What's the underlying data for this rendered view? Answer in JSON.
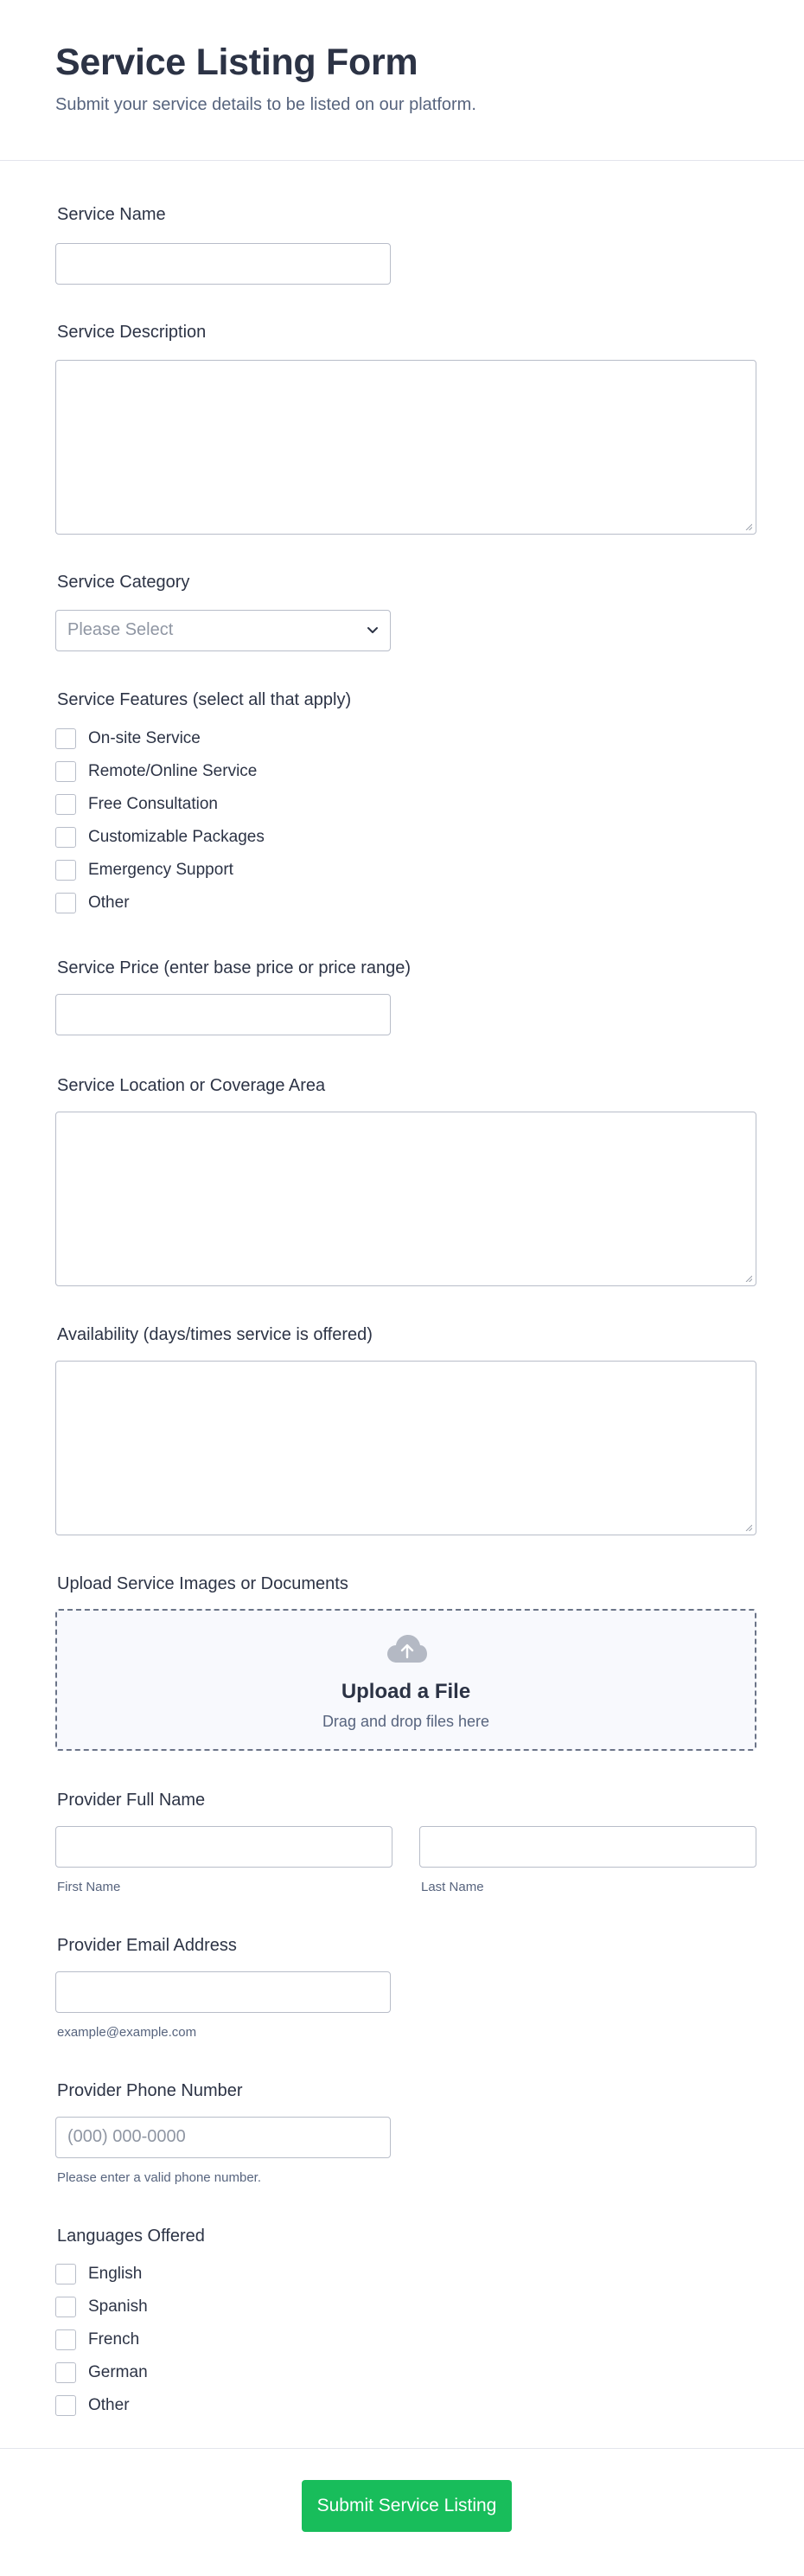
{
  "header": {
    "title": "Service Listing Form",
    "subtitle": "Submit your service details to be listed on our platform."
  },
  "fields": {
    "service_name": {
      "label": "Service Name",
      "value": ""
    },
    "service_description": {
      "label": "Service Description",
      "value": ""
    },
    "service_category": {
      "label": "Service Category",
      "placeholder": "Please Select"
    },
    "service_features": {
      "label": "Service Features (select all that apply)",
      "options": [
        {
          "label": "On-site Service",
          "checked": false
        },
        {
          "label": "Remote/Online Service",
          "checked": false
        },
        {
          "label": "Free Consultation",
          "checked": false
        },
        {
          "label": "Customizable Packages",
          "checked": false
        },
        {
          "label": "Emergency Support",
          "checked": false
        },
        {
          "label": "Other",
          "checked": false
        }
      ]
    },
    "service_price": {
      "label": "Service Price (enter base price or price range)",
      "value": ""
    },
    "service_location": {
      "label": "Service Location or Coverage Area",
      "value": ""
    },
    "availability": {
      "label": "Availability (days/times service is offered)",
      "value": ""
    },
    "upload": {
      "label": "Upload Service Images or Documents",
      "title": "Upload a File",
      "subtitle": "Drag and drop files here"
    },
    "provider_name": {
      "label": "Provider Full Name",
      "first_sublabel": "First Name",
      "last_sublabel": "Last Name"
    },
    "provider_email": {
      "label": "Provider Email Address",
      "sublabel": "example@example.com"
    },
    "provider_phone": {
      "label": "Provider Phone Number",
      "placeholder": "(000) 000-0000",
      "sublabel": "Please enter a valid phone number."
    },
    "languages": {
      "label": "Languages Offered",
      "options": [
        {
          "label": "English",
          "checked": false
        },
        {
          "label": "Spanish",
          "checked": false
        },
        {
          "label": "French",
          "checked": false
        },
        {
          "label": "German",
          "checked": false
        },
        {
          "label": "Other",
          "checked": false
        }
      ]
    }
  },
  "submit": {
    "label": "Submit Service Listing"
  },
  "colors": {
    "accent": "#18bd5b",
    "text": "#2c3345",
    "muted": "#57647e",
    "border": "#b8bdc9"
  },
  "icons": {
    "dropdown": "chevron-down-icon",
    "upload": "cloud-upload-icon",
    "resize": "resize-handle-icon"
  }
}
